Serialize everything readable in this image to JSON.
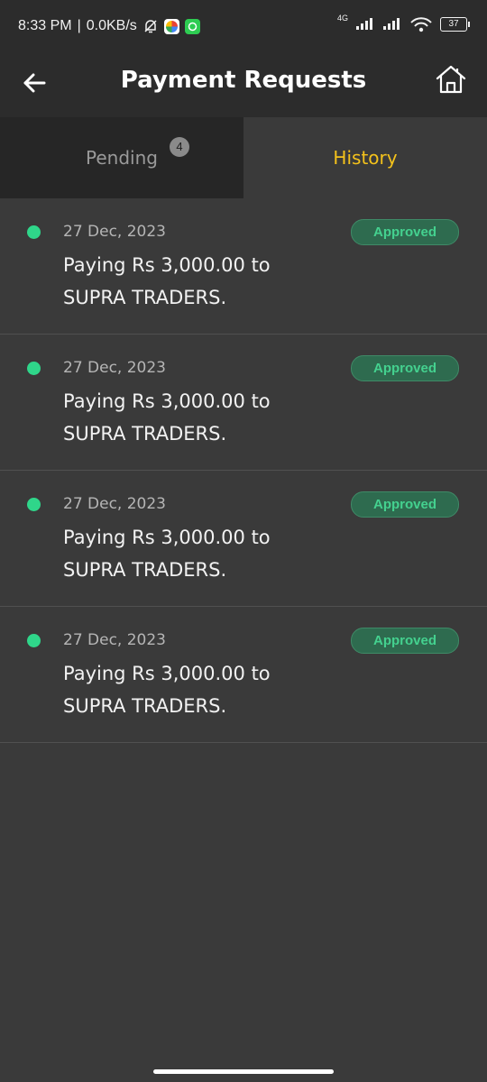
{
  "status_bar": {
    "time": "8:33 PM",
    "separator": "|",
    "speed": "0.0KB/s",
    "network": "4G",
    "battery": "37"
  },
  "header": {
    "title": "Payment Requests",
    "back_icon": "arrow-left-icon",
    "home_icon": "home-icon"
  },
  "tabs": [
    {
      "label": "Pending",
      "badge": "4",
      "active": false
    },
    {
      "label": "History",
      "active": true
    }
  ],
  "items": [
    {
      "date": "27 Dec, 2023",
      "description": "Paying Rs 3,000.00 to SUPRA TRADERS.",
      "status": "Approved"
    },
    {
      "date": "27 Dec, 2023",
      "description": "Paying Rs 3,000.00 to SUPRA TRADERS.",
      "status": "Approved"
    },
    {
      "date": "27 Dec, 2023",
      "description": "Paying Rs 3,000.00 to SUPRA TRADERS.",
      "status": "Approved"
    },
    {
      "date": "27 Dec, 2023",
      "description": "Paying Rs 3,000.00 to SUPRA TRADERS.",
      "status": "Approved"
    }
  ],
  "colors": {
    "accent": "#f4c21b",
    "approved_text": "#44d18f",
    "approved_bg": "#2e6b4f",
    "dot": "#2fd68a",
    "background": "#3a3a3a",
    "header": "#2c2c2c"
  }
}
